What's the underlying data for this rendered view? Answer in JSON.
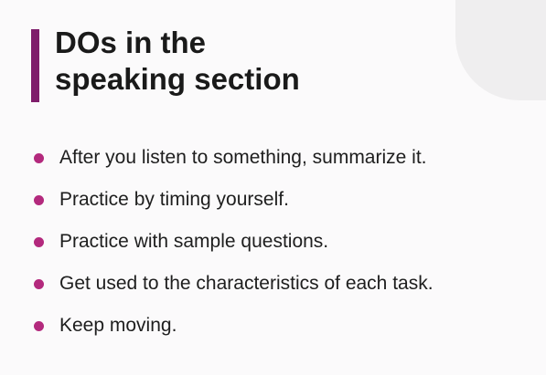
{
  "slide": {
    "title_line1": "DOs in the",
    "title_line2": "speaking section",
    "accent_color": "#7f1d6b",
    "bullet_color": "#b3297d",
    "bullets": [
      "After you listen to something, summarize it.",
      "Practice by timing yourself.",
      "Practice with sample questions.",
      "Get used to the characteristics of each task.",
      "Keep moving."
    ]
  }
}
